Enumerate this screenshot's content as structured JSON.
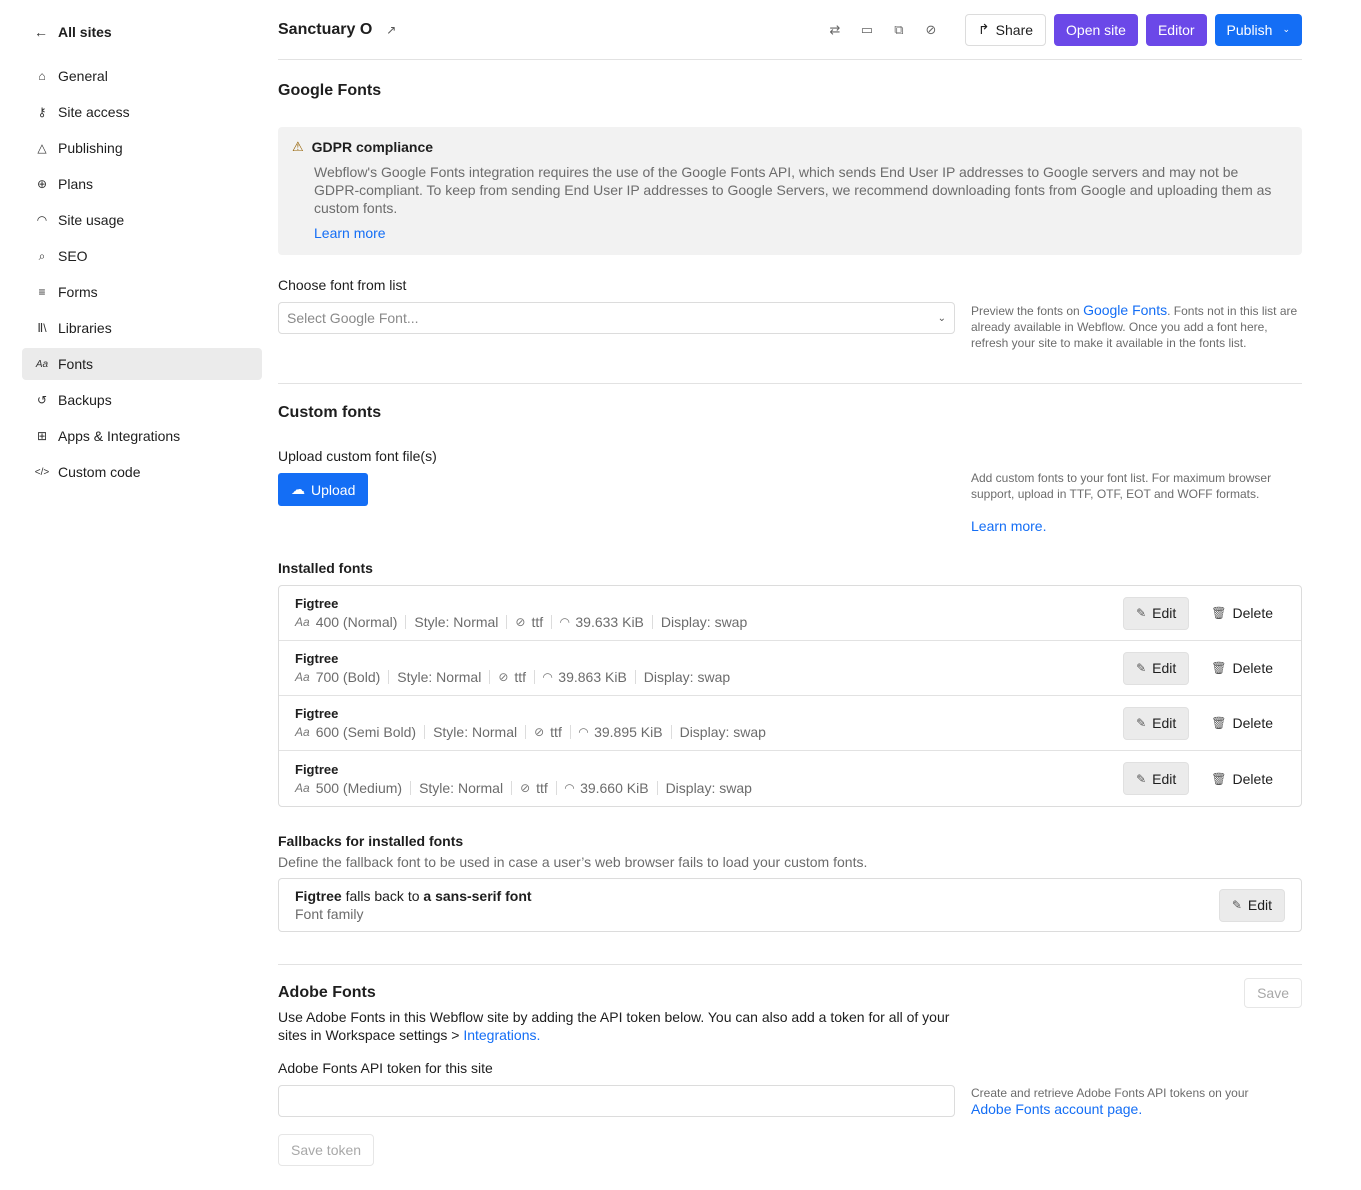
{
  "sidebar": {
    "back_label": "All sites",
    "items": [
      {
        "label": "General",
        "icon": "home-icon"
      },
      {
        "label": "Site access",
        "icon": "key-icon"
      },
      {
        "label": "Publishing",
        "icon": "publishing-icon"
      },
      {
        "label": "Plans",
        "icon": "plans-icon"
      },
      {
        "label": "Site usage",
        "icon": "gauge-icon"
      },
      {
        "label": "SEO",
        "icon": "search-icon"
      },
      {
        "label": "Forms",
        "icon": "forms-icon"
      },
      {
        "label": "Libraries",
        "icon": "libraries-icon"
      },
      {
        "label": "Fonts",
        "icon": "fonts-icon",
        "active": true
      },
      {
        "label": "Backups",
        "icon": "backup-icon"
      },
      {
        "label": "Apps & Integrations",
        "icon": "apps-icon"
      },
      {
        "label": "Custom code",
        "icon": "code-icon"
      }
    ]
  },
  "header": {
    "site_title": "Sanctuary O",
    "share_label": "Share",
    "open_site_label": "Open site",
    "editor_label": "Editor",
    "publish_label": "Publish"
  },
  "google_fonts": {
    "title": "Google Fonts",
    "gdpr_title": "GDPR compliance",
    "gdpr_body": "Webflow's Google Fonts integration requires the use of the Google Fonts API, which sends End User IP addresses to Google servers and may not be GDPR-compliant. To keep from sending End User IP addresses to Google Servers, we recommend downloading fonts from Google and uploading them as custom fonts.",
    "learn_more": "Learn more",
    "choose_label": "Choose font from list",
    "select_placeholder": "Select Google Font...",
    "help_prefix": "Preview the fonts on ",
    "help_link": "Google Fonts",
    "help_suffix": ". Fonts not in this list are already available in Webflow. Once you add a font here, refresh your site to make it available in the fonts list."
  },
  "custom_fonts": {
    "title": "Custom fonts",
    "upload_label": "Upload custom font file(s)",
    "upload_button": "Upload",
    "help": "Add custom fonts to your font list. For maximum browser support, upload in TTF, OTF, EOT and WOFF formats.",
    "learn_more": "Learn more."
  },
  "installed": {
    "title": "Installed fonts",
    "edit_label": "Edit",
    "delete_label": "Delete",
    "rows": [
      {
        "name": "Figtree",
        "weight": "400 (Normal)",
        "style": "Style: Normal",
        "format": "ttf",
        "size": "39.633 KiB",
        "display": "Display: swap"
      },
      {
        "name": "Figtree",
        "weight": "700 (Bold)",
        "style": "Style: Normal",
        "format": "ttf",
        "size": "39.863 KiB",
        "display": "Display: swap"
      },
      {
        "name": "Figtree",
        "weight": "600 (Semi Bold)",
        "style": "Style: Normal",
        "format": "ttf",
        "size": "39.895 KiB",
        "display": "Display: swap"
      },
      {
        "name": "Figtree",
        "weight": "500 (Medium)",
        "style": "Style: Normal",
        "format": "ttf",
        "size": "39.660 KiB",
        "display": "Display: swap"
      }
    ]
  },
  "fallbacks": {
    "title": "Fallbacks for installed fonts",
    "description": "Define the fallback font to be used in case a user’s web browser fails to load your custom fonts.",
    "font": "Figtree",
    "mid": " falls back to ",
    "target": "a sans-serif font",
    "sub": "Font family",
    "edit_label": "Edit"
  },
  "adobe": {
    "title": "Adobe Fonts",
    "save_label": "Save",
    "desc_prefix": "Use Adobe Fonts in this Webflow site by adding the API token below. You can also add a token for all of your sites in Workspace settings > ",
    "desc_link": "Integrations.",
    "token_label": "Adobe Fonts API token for this site",
    "help_prefix": "Create and retrieve Adobe Fonts API tokens on your ",
    "help_link": "Adobe Fonts account page.",
    "save_token_label": "Save token"
  }
}
